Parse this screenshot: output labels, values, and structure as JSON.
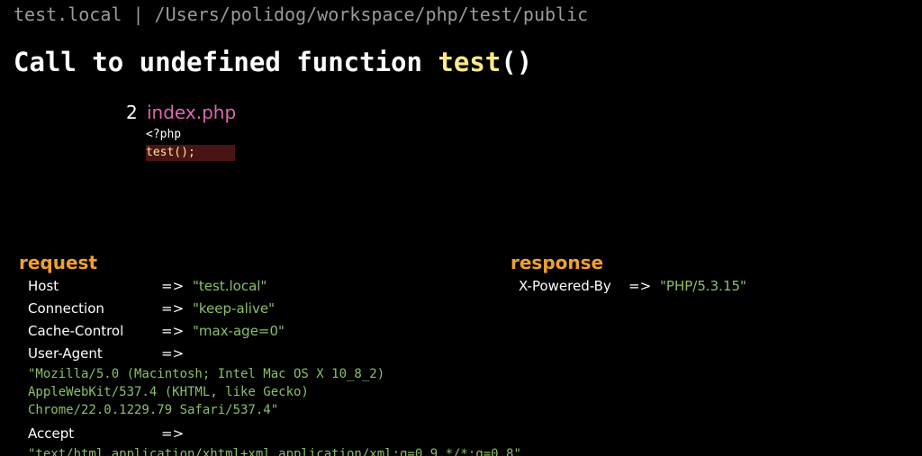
{
  "header": {
    "path": "test.local | /Users/polidog/workspace/php/test/public"
  },
  "error": {
    "prefix": "Call to undefined function ",
    "function_name": "test",
    "suffix": "()"
  },
  "frame": {
    "number": "2",
    "file": "index.php",
    "code_line_1": "<?php",
    "code_line_2": "test();"
  },
  "request": {
    "heading": "request",
    "headers": [
      {
        "key": "Host",
        "arrow": "=>",
        "value": "\"test.local\""
      },
      {
        "key": "Connection",
        "arrow": "=>",
        "value": "\"keep-alive\""
      },
      {
        "key": "Cache-Control",
        "arrow": "=>",
        "value": "\"max-age=0\""
      },
      {
        "key": "User-Agent",
        "arrow": "=>",
        "value": ""
      },
      {
        "key": "Accept",
        "arrow": "=>",
        "value": ""
      }
    ],
    "user_agent_lines": [
      "\"Mozilla/5.0 (Macintosh; Intel Mac OS X 10_8_2)",
      "AppleWebKit/537.4 (KHTML, like Gecko)",
      "Chrome/22.0.1229.79 Safari/537.4\""
    ],
    "accept_line": "\"text/html,application/xhtml+xml,application/xml;q=0.9,*/*;q=0.8\""
  },
  "response": {
    "heading": "response",
    "headers": [
      {
        "key": "X-Powered-By",
        "arrow": "=>",
        "value": "\"PHP/5.3.15\""
      }
    ]
  },
  "colors": {
    "background": "#000000",
    "path_gray": "#9a9a9a",
    "function_yellow": "#ffe98a",
    "file_pink": "#d96aac",
    "heading_orange": "#f0a030",
    "value_green": "#8cbf6a",
    "highlight_red": "#4a1414"
  }
}
